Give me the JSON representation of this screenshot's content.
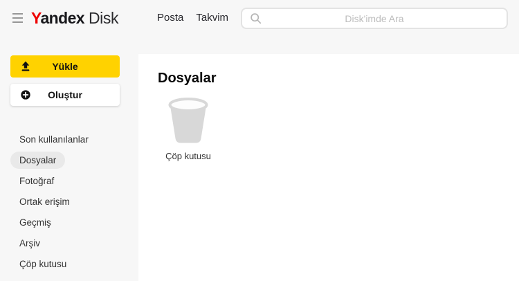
{
  "header": {
    "logo": {
      "brand_first_letter": "Y",
      "brand_rest": "andex",
      "product": "Disk"
    },
    "links": [
      {
        "label": "Posta"
      },
      {
        "label": "Takvim"
      }
    ],
    "search": {
      "placeholder": "Disk'imde Ara",
      "value": "",
      "icon": "search-icon"
    },
    "menu_icon": "hamburger-icon"
  },
  "sidebar": {
    "upload_button": {
      "label": "Yükle",
      "icon": "upload-icon"
    },
    "create_button": {
      "label": "Oluştur",
      "icon": "plus-circle-icon"
    },
    "items": [
      {
        "label": "Son kullanılanlar",
        "active": false
      },
      {
        "label": "Dosyalar",
        "active": true
      },
      {
        "label": "Fotoğraf",
        "active": false
      },
      {
        "label": "Ortak erişim",
        "active": false
      },
      {
        "label": "Geçmiş",
        "active": false
      },
      {
        "label": "Arşiv",
        "active": false
      },
      {
        "label": "Çöp kutusu",
        "active": false
      }
    ]
  },
  "main": {
    "title": "Dosyalar",
    "tiles": [
      {
        "label": "Çöp kutusu",
        "icon": "trash-icon"
      }
    ]
  },
  "colors": {
    "accent_yellow": "#ffd200",
    "brand_red": "#ee0000",
    "page_bg": "#f7f7f7",
    "panel_bg": "#ffffff",
    "active_pill": "#e9e9e9",
    "placeholder_gray": "#bdbdbd"
  }
}
